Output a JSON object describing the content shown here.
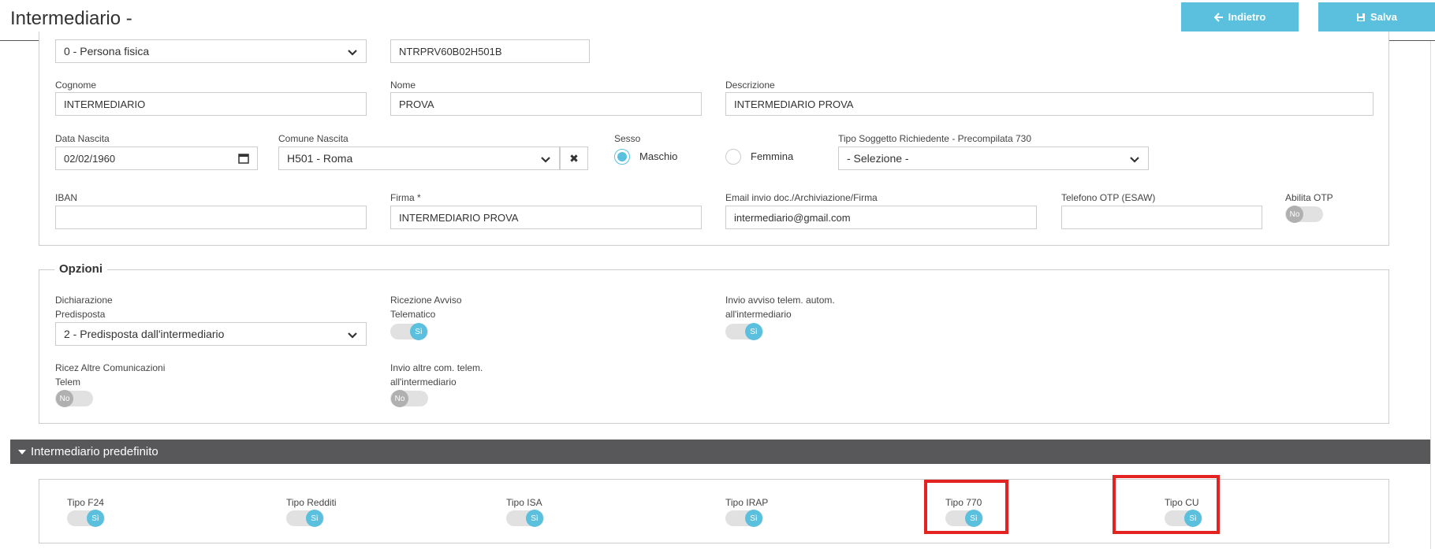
{
  "header": {
    "title": "Intermediario -",
    "back_label": "Indietro",
    "save_label": "Salva"
  },
  "anagrafica": {
    "tipo_persona": "0 - Persona fisica",
    "codice_fiscale": "NTRPRV60B02H501B",
    "cognome_label": "Cognome",
    "cognome": "INTERMEDIARIO",
    "nome_label": "Nome",
    "nome": "PROVA",
    "descrizione_label": "Descrizione",
    "descrizione": "INTERMEDIARIO PROVA",
    "data_nascita_label": "Data Nascita",
    "data_nascita": "02/02/1960",
    "comune_nascita_label": "Comune Nascita",
    "comune_nascita": "H501 - Roma",
    "sesso_label": "Sesso",
    "sesso_maschio": "Maschio",
    "sesso_femmina": "Femmina",
    "tipo_soggetto_label": "Tipo Soggetto Richiedente - Precompilata 730",
    "tipo_soggetto": "- Selezione -",
    "iban_label": "IBAN",
    "iban": "",
    "firma_label": "Firma *",
    "firma": "INTERMEDIARIO PROVA",
    "email_label": "Email invio doc./Archiviazione/Firma",
    "email": "intermediario@gmail.com",
    "telefono_label": "Telefono OTP (ESAW)",
    "telefono": "",
    "abilita_otp_label": "Abilita OTP",
    "abilita_otp": "No"
  },
  "opzioni": {
    "legend": "Opzioni",
    "dichiarazione_label_1": "Dichiarazione",
    "dichiarazione_label_2": "Predisposta",
    "dichiarazione": "2 - Predisposta dall'intermediario",
    "ricezione_label_1": "Ricezione Avviso",
    "ricezione_label_2": "Telematico",
    "ricezione": "Sì",
    "invio_avviso_label_1": "Invio avviso telem. autom.",
    "invio_avviso_label_2": "all'intermediario",
    "invio_avviso": "Sì",
    "ricez_altre_label_1": "Ricez Altre Comunicazioni",
    "ricez_altre_label_2": "Telem",
    "ricez_altre": "No",
    "invio_altre_label_1": "Invio altre com. telem.",
    "invio_altre_label_2": "all'intermediario",
    "invio_altre": "No"
  },
  "predefinito": {
    "section_title": "Intermediario predefinito",
    "items": [
      {
        "label": "Tipo F24",
        "value": "Sì"
      },
      {
        "label": "Tipo Redditi",
        "value": "Sì"
      },
      {
        "label": "Tipo ISA",
        "value": "Sì"
      },
      {
        "label": "Tipo IRAP",
        "value": "Sì"
      },
      {
        "label": "Tipo 770",
        "value": "Sì"
      },
      {
        "label": "Tipo CU",
        "value": "Sì"
      }
    ]
  },
  "colors": {
    "accent": "#5bc0de",
    "section_bar": "#58585a",
    "highlight": "#e32222"
  }
}
